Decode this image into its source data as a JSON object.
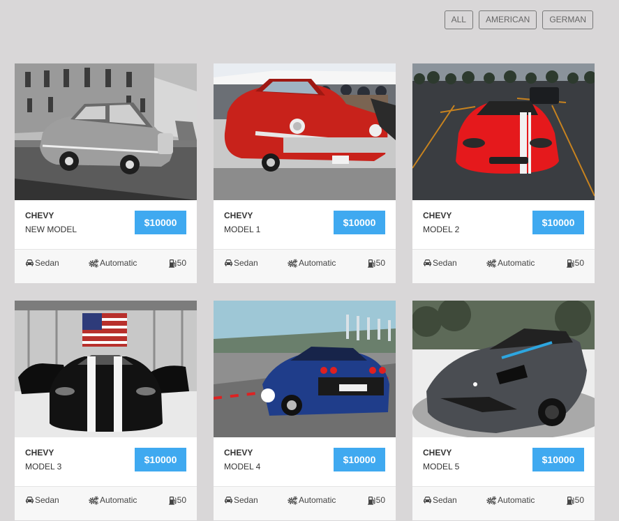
{
  "filters": [
    {
      "label": "ALL"
    },
    {
      "label": "AMERICAN"
    },
    {
      "label": "GERMAN"
    }
  ],
  "cars": [
    {
      "brand": "CHEVY",
      "model": "NEW MODEL",
      "price": "$10000",
      "body": "Sedan",
      "transmission": "Automatic",
      "fuel": "50",
      "photo": "bw-vintage-sedan"
    },
    {
      "brand": "CHEVY",
      "model": "MODEL 1",
      "price": "$10000",
      "body": "Sedan",
      "transmission": "Automatic",
      "fuel": "50",
      "photo": "red-classic-chevy"
    },
    {
      "brand": "CHEVY",
      "model": "MODEL 2",
      "price": "$10000",
      "body": "Sedan",
      "transmission": "Automatic",
      "fuel": "50",
      "photo": "red-viper"
    },
    {
      "brand": "CHEVY",
      "model": "MODEL 3",
      "price": "$10000",
      "body": "Sedan",
      "transmission": "Automatic",
      "fuel": "50",
      "photo": "black-viper-garage"
    },
    {
      "brand": "CHEVY",
      "model": "MODEL 4",
      "price": "$10000",
      "body": "Sedan",
      "transmission": "Automatic",
      "fuel": "50",
      "photo": "blue-ferrari-track"
    },
    {
      "brand": "CHEVY",
      "model": "MODEL 5",
      "price": "$10000",
      "body": "Sedan",
      "transmission": "Automatic",
      "fuel": "50",
      "photo": "grey-corvette"
    }
  ],
  "icons": {
    "body": "car-icon",
    "transmission": "gears-icon",
    "fuel": "gas-pump-icon"
  },
  "colors": {
    "background": "#d9d7d8",
    "price": "#3fa9f0",
    "card": "#ffffff"
  }
}
